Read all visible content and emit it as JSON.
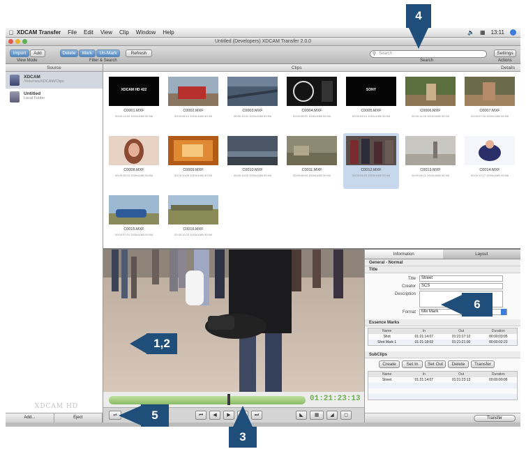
{
  "menubar": {
    "app": "XDCAM Transfer",
    "items": [
      "File",
      "Edit",
      "View",
      "Clip",
      "Window",
      "Help"
    ],
    "clock": "13:11"
  },
  "window": {
    "title": "Untitled (Developers) XDCAM Transfer 2.0.0"
  },
  "toolbar": {
    "buttons": [
      "Import",
      "Add",
      "Delete",
      "Mark",
      "Un-Mark",
      "Refresh"
    ],
    "group_labels": [
      "View Mode",
      "Filter & Search",
      "Search",
      "Actions"
    ],
    "search_placeholder": "Search",
    "right_button": "Settings"
  },
  "sidebar": {
    "header": "Source",
    "sources": [
      {
        "title": "XDCAM",
        "subtitle": "/Volumes/XDCAM/Clips"
      },
      {
        "title": "Untitled",
        "subtitle": "Local Folder"
      }
    ],
    "logo_text": "XDCAM HD",
    "footer_buttons": [
      "Add...",
      "Eject"
    ]
  },
  "grid": {
    "header_left": "Clips",
    "header_right": "Details",
    "clips": [
      {
        "name": "C0001.MXF",
        "meta": "00:00:12:00 1920x1080 59.94i",
        "style": "black-title",
        "caption": "XDCAM HD 422"
      },
      {
        "name": "C0002.MXF",
        "meta": "00:00:08:10 1920x1080 59.94i",
        "style": "red-truck"
      },
      {
        "name": "C0003.MXF",
        "meta": "00:00:15:02 1920x1080 59.94i",
        "style": "city-aerial"
      },
      {
        "name": "C0004.MXF",
        "meta": "00:00:06:21 1920x1080 59.94i",
        "style": "gauge"
      },
      {
        "name": "C0005.MXF",
        "meta": "00:00:09:14 1920x1080 59.94i",
        "style": "black-title",
        "caption": "SONY"
      },
      {
        "name": "C0006.MXF",
        "meta": "00:00:11:05 1920x1080 59.94i",
        "style": "rider"
      },
      {
        "name": "C0007.MXF",
        "meta": "00:00:07:18 1920x1080 59.94i",
        "style": "rider2"
      },
      {
        "name": "C0008.MXF",
        "meta": "00:00:05:22 1920x1080 59.94i",
        "style": "woman"
      },
      {
        "name": "C0009.MXF",
        "meta": "00:00:10:09 1920x1080 59.94i",
        "style": "orange-room"
      },
      {
        "name": "C0010.MXF",
        "meta": "00:00:13:00 1920x1080 59.94i",
        "style": "sky"
      },
      {
        "name": "C0011.MXF",
        "meta": "00:00:08:03 1920x1080 59.94i",
        "style": "ruins"
      },
      {
        "name": "C0012.MXF",
        "meta": "00:00:09:20 1920x1080 59.94i",
        "style": "crowd"
      },
      {
        "name": "C0013.MXF",
        "meta": "00:00:06:11 1920x1080 59.94i",
        "style": "beach"
      },
      {
        "name": "C0014.MXF",
        "meta": "00:00:12:17 1920x1080 59.94i",
        "style": "snow"
      },
      {
        "name": "C0015.MXF",
        "meta": "00:00:07:01 1920x1080 59.94i",
        "style": "blue-car"
      },
      {
        "name": "C0016.MXF",
        "meta": "00:00:10:24 1920x1080 59.94i",
        "style": "field"
      }
    ],
    "selected_index": 11
  },
  "viewer": {
    "timecode": "01:21:23:13",
    "scrub_position": 0.61
  },
  "info": {
    "tabs": [
      "Information",
      "Layout"
    ],
    "sections": {
      "general": "General - Normal",
      "title": "Title",
      "essence": "Essence Marks",
      "subclips": "SubClips"
    },
    "fields": {
      "title_label": "Title",
      "title_value": "Street",
      "creator_label": "Creator",
      "creator_value": "SCS",
      "description_label": "Description",
      "description_value": "",
      "format_label": "Format",
      "format_value": "Mix Mark"
    },
    "essence_headers": [
      "Name",
      "In",
      "Out",
      "Duration"
    ],
    "essence_rows": [
      [
        "Shot",
        "01:21:14:07",
        "01:21:17:12",
        "00:00:03:05"
      ],
      [
        "Shot Mark 1",
        "01:21:18:02",
        "01:21:21:00",
        "00:00:02:23"
      ]
    ],
    "subclip_buttons": [
      "Create",
      "Set In",
      "Set Out",
      "Delete",
      "Transfer"
    ],
    "subclip_headers": [
      "Name",
      "In",
      "Out",
      "Duration"
    ],
    "subclip_rows": [
      [
        "Street",
        "01:21:14:07",
        "01:21:23:13",
        "00:00:09:06"
      ]
    ],
    "transfer_button": "Transfer"
  },
  "callouts": [
    "1,2",
    "3",
    "4",
    "5",
    "6"
  ]
}
